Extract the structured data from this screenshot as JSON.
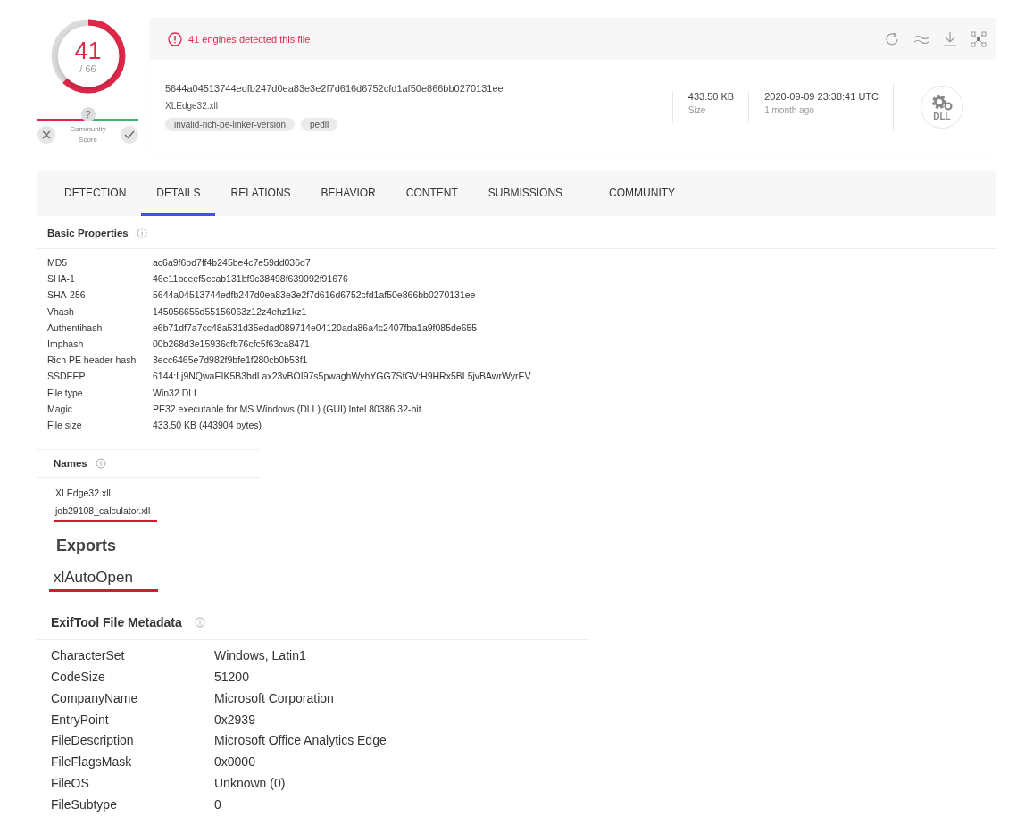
{
  "score": {
    "detected": "41",
    "total": "/ 66",
    "level": 0.621
  },
  "community": {
    "marker": "?",
    "label": "Community Score"
  },
  "alert": "41 engines detected this file",
  "file": {
    "hash": "5644a04513744edfb247d0ea83e3e2f7d616d6752cfd1af50e866bb0270131ee",
    "name": "XLEdge32.xll",
    "tags": [
      "invalid-rich-pe-linker-version",
      "pedll"
    ],
    "size": "433.50 KB",
    "size_label": "Size",
    "date": "2020-09-09 23:38:41 UTC",
    "date_ago": "1 month ago",
    "type_badge": "DLL"
  },
  "tabs": [
    {
      "label": "DETECTION",
      "selected": false
    },
    {
      "label": "DETAILS",
      "selected": true
    },
    {
      "label": "RELATIONS",
      "selected": false
    },
    {
      "label": "BEHAVIOR",
      "selected": false
    },
    {
      "label": "CONTENT",
      "selected": false
    },
    {
      "label": "SUBMISSIONS",
      "selected": false
    },
    {
      "label": "COMMUNITY",
      "selected": false
    }
  ],
  "basic_properties": {
    "title": "Basic Properties",
    "rows": [
      {
        "label": "MD5",
        "value": "ac6a9f6bd7ff4b245be4c7e59dd036d7"
      },
      {
        "label": "SHA-1",
        "value": "46e11bceef5ccab131bf9c38498f639092f91676"
      },
      {
        "label": "SHA-256",
        "value": "5644a04513744edfb247d0ea83e3e2f7d616d6752cfd1af50e866bb0270131ee"
      },
      {
        "label": "Vhash",
        "value": "145056655d55156063z12z4ehz1kz1"
      },
      {
        "label": "Authentihash",
        "value": "e6b71df7a7cc48a531d35edad089714e04120ada86a4c2407fba1a9f085de655"
      },
      {
        "label": "Imphash",
        "value": "00b268d3e15936cfb76cfc5f63ca8471"
      },
      {
        "label": "Rich PE header hash",
        "value": "3ecc6465e7d982f9bfe1f280cb0b53f1"
      },
      {
        "label": "SSDEEP",
        "value": "6144:Lj9NQwaEIK5B3bdLax23vBOI97s5pwaghWyhYGG7SfGV:H9HRx5BL5jvBAwrWyrEV"
      },
      {
        "label": "File type",
        "value": "Win32 DLL"
      },
      {
        "label": "Magic",
        "value": "PE32 executable for MS Windows (DLL) (GUI) Intel 80386 32-bit"
      },
      {
        "label": "File size",
        "value": "433.50 KB (443904 bytes)"
      }
    ]
  },
  "names": {
    "title": "Names",
    "items": [
      {
        "text": "XLEdge32.xll",
        "highlighted": false
      },
      {
        "text": "job29108_calculator.xll",
        "highlighted": true
      }
    ]
  },
  "exports": {
    "title": "Exports",
    "items": [
      {
        "text": "xlAutoOpen",
        "highlighted": true
      }
    ]
  },
  "exiftool": {
    "title": "ExifTool File Metadata",
    "rows": [
      {
        "label": "CharacterSet",
        "value": "Windows, Latin1"
      },
      {
        "label": "CodeSize",
        "value": "51200"
      },
      {
        "label": "CompanyName",
        "value": "Microsoft Corporation"
      },
      {
        "label": "EntryPoint",
        "value": "0x2939"
      },
      {
        "label": "FileDescription",
        "value": "Microsoft Office Analytics Edge"
      },
      {
        "label": "FileFlagsMask",
        "value": "0x0000"
      },
      {
        "label": "FileOS",
        "value": "Unknown (0)"
      },
      {
        "label": "FileSubtype",
        "value": "0"
      }
    ]
  }
}
